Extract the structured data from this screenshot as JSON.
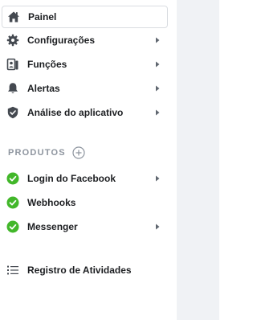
{
  "sidebar": {
    "items": [
      {
        "label": "Painel",
        "icon": "home-icon",
        "active": true,
        "has_submenu": false
      },
      {
        "label": "Configurações",
        "icon": "gear-icon",
        "active": false,
        "has_submenu": true
      },
      {
        "label": "Funções",
        "icon": "roles-icon",
        "active": false,
        "has_submenu": true
      },
      {
        "label": "Alertas",
        "icon": "bell-icon",
        "active": false,
        "has_submenu": true
      },
      {
        "label": "Análise do aplicativo",
        "icon": "shield-icon",
        "active": false,
        "has_submenu": true
      }
    ],
    "products_header": "PRODUTOS",
    "products": [
      {
        "label": "Login do Facebook",
        "icon": "check-circle-icon",
        "has_submenu": true
      },
      {
        "label": "Webhooks",
        "icon": "check-circle-icon",
        "has_submenu": false
      },
      {
        "label": "Messenger",
        "icon": "check-circle-icon",
        "has_submenu": true
      }
    ],
    "activity_log": {
      "label": "Registro de Atividades",
      "icon": "list-icon"
    }
  },
  "colors": {
    "text": "#1c1e21",
    "icon": "#444950",
    "success": "#42b72a",
    "section_header": "#8d949e",
    "right_pane": "#f0f2f5"
  }
}
